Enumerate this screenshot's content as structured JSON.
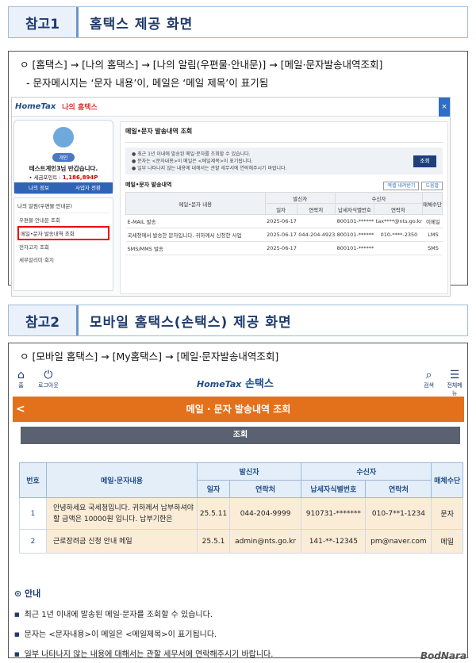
{
  "section1": {
    "tag": "참고1",
    "title": "홈택스 제공 화면",
    "path": "ㅇ [홈택스] → [나의 홈택스] → [나의 알림(우편물·안내문)] → [메일·문자발송내역조회]",
    "note": "- 문자메시지는 ‘문자 내용’이, 메일은 ‘메일 제목’이 표기됨"
  },
  "pc": {
    "logo": "HomeTax",
    "logo_my": "나의 홈택스",
    "close": "×",
    "badge": "개인",
    "name": "테스트계인3님 반갑습니다.",
    "point_label": "• 세금포인트 : ",
    "points": "1,186,894P",
    "btn_my": "나의 정보",
    "btn_biz": "사업자 전환",
    "menu_head": "나의 알림(우편물·안내문)",
    "menu_items": [
      "우편물·안내문 조회",
      "메일•문자 발송내역 조회",
      "전자고지 조회",
      "세무알리미·회지"
    ],
    "page_title": "메일•문자 발송내역 조회",
    "info": [
      "● 최근 1년 이내에 발송된 메일·문자를 조회할 수 있습니다.",
      "● 문자는 <문자내용>이 메일은 <메일제목>이 표기됩니다.",
      "● 일부 나타나지 않는 내용에 대해서는 관할 세무서에 연락해주시기 바랍니다."
    ],
    "query": "조회",
    "list_title": "메일•문자 발송내역",
    "excel": "엑셀 내려받기",
    "print": "도움말",
    "headers": [
      "메일•문자 내용",
      "발신자",
      "수신자",
      "매체수단",
      "일자",
      "연락처",
      "납세자식별번호",
      "연락처"
    ],
    "rows": [
      [
        "E-MAIL 발송",
        "2025-06-17",
        "",
        "800101-******",
        "tax****@nts.go.kr",
        "이메일"
      ],
      [
        "국세청에서 발송한 문자입니다. 귀하께서 신청한 사업",
        "2025-06-17",
        "044-204-4923",
        "800101-******",
        "010-****-2350",
        "LMS"
      ],
      [
        "SMS/MMS 발송",
        "2025-06-17",
        "",
        "800101-******",
        "",
        "SMS"
      ]
    ]
  },
  "section2": {
    "tag": "참고2",
    "title": "모바일 홈택스(손택스) 제공 화면",
    "path": "ㅇ [모바일 홈택스] → [My홈택스] → [메일·문자발송내역조회]"
  },
  "mobile": {
    "home": "홈",
    "logout": "로그아웃",
    "logo": "HomeTax",
    "logo_kr": "손택스",
    "search": "검색",
    "menu": "전체메뉴",
    "header": "메일 · 문자 발송내역 조회",
    "back": "<",
    "query": "조회",
    "headers": [
      "번호",
      "메일·문자내용",
      "발신자",
      "수신자",
      "매체수단",
      "일자",
      "연락처",
      "납세자식별번호",
      "연락처"
    ],
    "rows": [
      [
        "1",
        "안녕하세요 국세청입니다. 귀하께서 납부하셔야할 금액은 10000원 입니다. 납부기한은",
        "25.5.11",
        "044-204-9999",
        "910731-*******",
        "010-7**1-1234",
        "문자"
      ],
      [
        "2",
        "근로장려금 신청 안내 메일",
        "25.5.1",
        "admin@nts.go.kr",
        "141-**-12345",
        "pm@naver.com",
        "메일"
      ]
    ],
    "guide_title": "⊙ 안내",
    "guide": [
      "최근 1년 이내에 발송된 메일·문자를 조회할 수 있습니다.",
      "문자는 <문자내용>이 메일은 <메일제목>이 표기됩니다.",
      "일부 나타나지 않는 내용에 대해서는 관할 세무서에 연락해주시기 바랍니다."
    ],
    "bullet": "■"
  },
  "watermark": "BodNara"
}
